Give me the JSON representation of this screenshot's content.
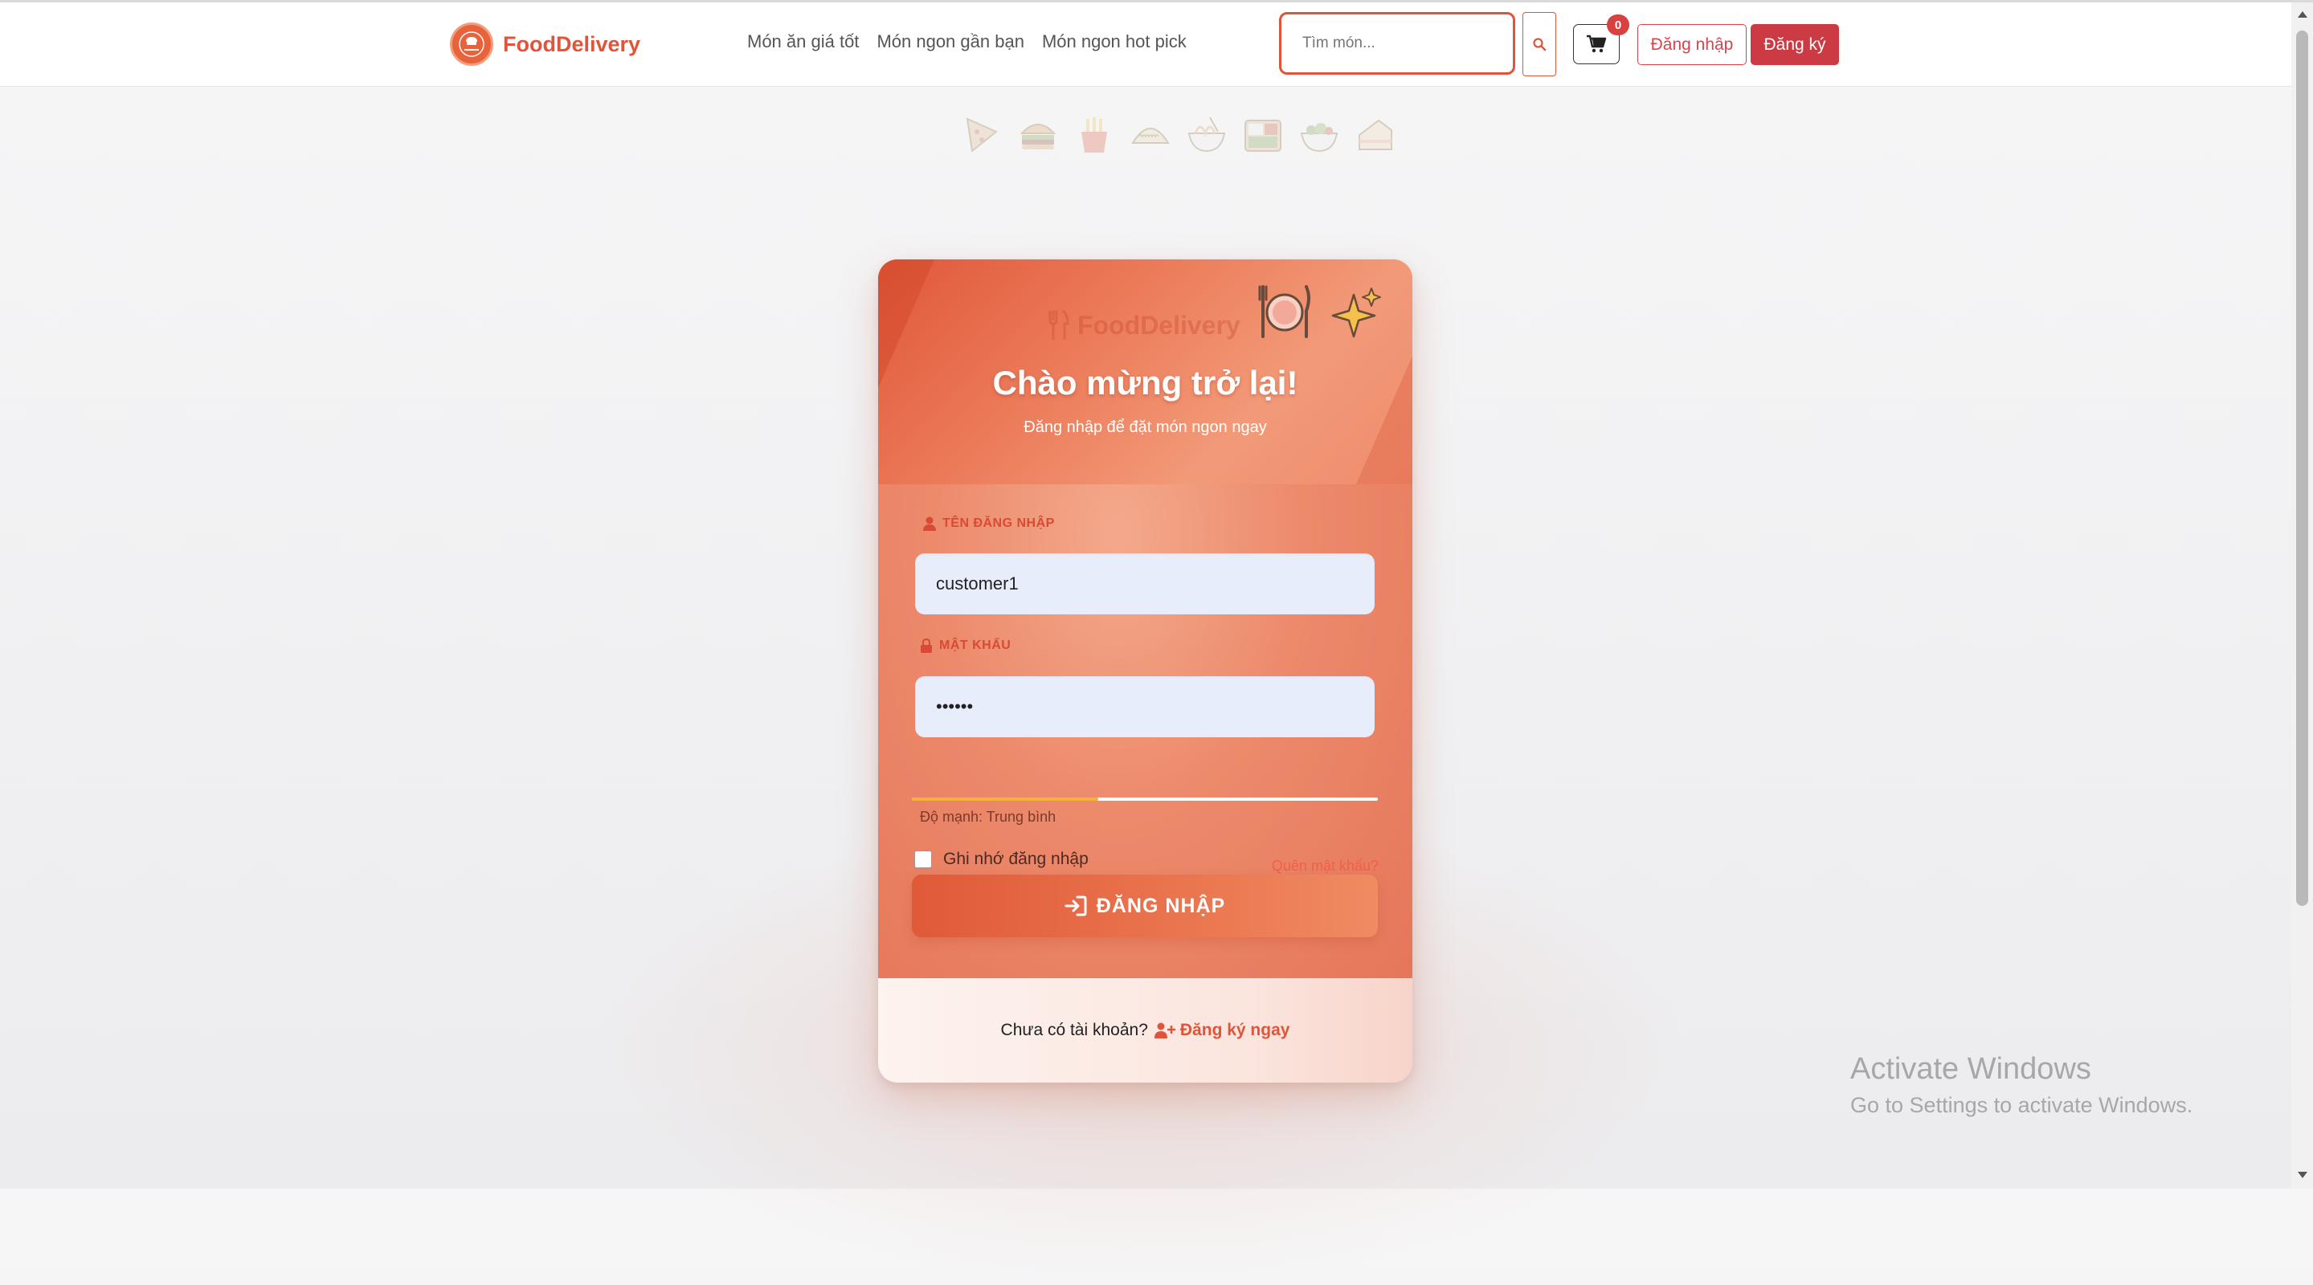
{
  "brand": {
    "name": "FoodDelivery",
    "logo_icon": "chef-logo-icon",
    "color": "#e0543a"
  },
  "nav": {
    "links": [
      {
        "label": "Món ăn giá tốt"
      },
      {
        "label": "Món ngon gần bạn"
      },
      {
        "label": "Món ngon hot pick"
      }
    ],
    "search_placeholder": "Tìm món...",
    "search_icon": "search-icon",
    "cart_icon": "cart-icon",
    "cart_count": "0",
    "login_label": "Đăng nhập",
    "register_label": "Đăng ký"
  },
  "decor": {
    "food_icons": [
      "pizza-slice-icon",
      "burger-icon",
      "fries-icon",
      "dumpling-icon",
      "noodle-bowl-icon",
      "bento-icon",
      "salad-bowl-icon",
      "cake-icon"
    ]
  },
  "card": {
    "watermark": "FoodDelivery",
    "title": "Chào mừng trở lại!",
    "subtitle": "Đăng nhập để đặt món ngon ngay",
    "username": {
      "label": "TÊN ĐĂNG NHẬP",
      "value": "customer1",
      "icon": "user-icon"
    },
    "password": {
      "label": "MẬT KHẨU",
      "value": "••••••",
      "icon": "lock-icon"
    },
    "strength": {
      "text": "Độ mạnh: Trung bình",
      "level": 0.4,
      "color": "#f4b23a"
    },
    "remember_label": "Ghi nhớ đăng nhập",
    "forgot_label": "Quên mật khẩu?",
    "submit_label": "ĐĂNG NHẬP",
    "footer_text": "Chưa có tài khoản?",
    "footer_link": "Đăng ký ngay"
  },
  "os_watermark": {
    "title": "Activate Windows",
    "subtitle": "Go to Settings to activate Windows."
  },
  "colors": {
    "accent": "#e0543a",
    "danger": "#cc3b44",
    "input_bg": "#e8edfb"
  }
}
